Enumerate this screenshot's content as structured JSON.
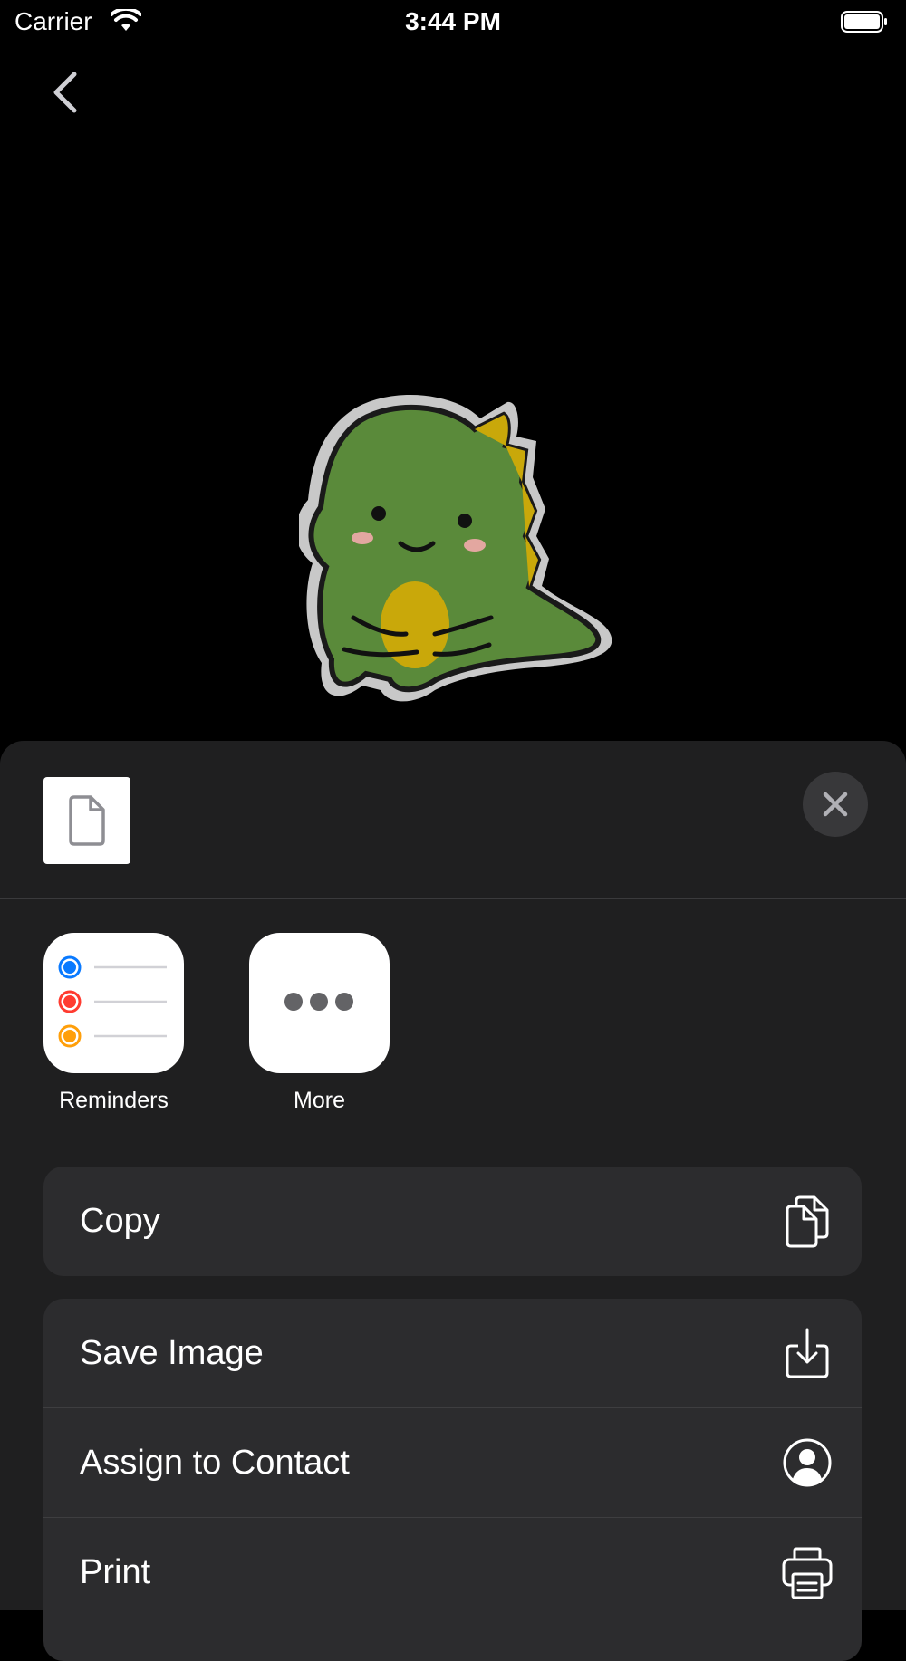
{
  "status_bar": {
    "carrier": "Carrier",
    "time": "3:44 PM"
  },
  "share_sheet": {
    "apps": [
      {
        "label": "Reminders",
        "icon": "reminders-icon"
      },
      {
        "label": "More",
        "icon": "more-icon"
      }
    ],
    "actions": {
      "copy": "Copy",
      "save_image": "Save Image",
      "assign_to_contact": "Assign to Contact",
      "print": "Print"
    }
  },
  "colors": {
    "sheet_background": "#1f1f20",
    "row_background": "#2c2c2e",
    "reminder_blue": "#0a7aff",
    "reminder_red": "#ff3b30",
    "reminder_orange": "#ff9f0a",
    "sticker_green": "#5a8a3a",
    "sticker_yellow": "#c9a80a"
  }
}
